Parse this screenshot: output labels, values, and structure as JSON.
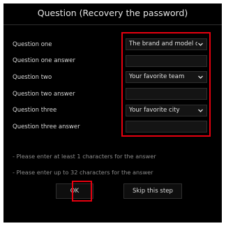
{
  "dialog": {
    "title": "Question (Recovery the password)",
    "questions": [
      {
        "label": "Question one",
        "value": "The brand and model of..."
      },
      {
        "label": "Question one answer",
        "value": ""
      },
      {
        "label": "Question two",
        "value": "Your favorite team"
      },
      {
        "label": "Question two answer",
        "value": ""
      },
      {
        "label": "Question three",
        "value": "Your favorite city"
      },
      {
        "label": "Question three answer",
        "value": ""
      }
    ],
    "notes": [
      "- Please enter at least 1 characters for the answer",
      "- Please enter up to 32 characters for the answer"
    ],
    "buttons": {
      "ok": "OK",
      "skip": "Skip this step"
    }
  },
  "colors": {
    "highlight": "#e8000f",
    "background": "#000000",
    "text": "#d9d9d9",
    "note": "#8c8c8c"
  },
  "icons": {
    "dropdown": "chevron-down-icon"
  }
}
